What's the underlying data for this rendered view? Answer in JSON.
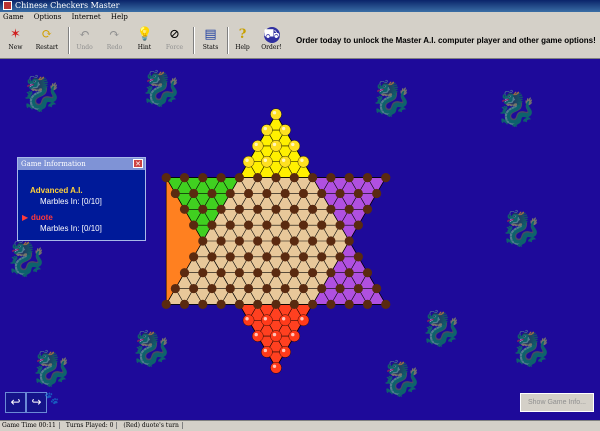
{
  "window": {
    "title": "Chinese Checkers Master"
  },
  "menu": [
    "Game",
    "Options",
    "Internet",
    "Help"
  ],
  "toolbar": [
    {
      "label": "New",
      "icon": "star-icon",
      "enabled": true
    },
    {
      "label": "Restart",
      "icon": "restart-icon",
      "enabled": true
    },
    {
      "label": "Undo",
      "icon": "undo-icon",
      "enabled": false
    },
    {
      "label": "Redo",
      "icon": "redo-icon",
      "enabled": false
    },
    {
      "label": "Hint",
      "icon": "lightbulb-icon",
      "enabled": true
    },
    {
      "label": "Force",
      "icon": "no-icon",
      "enabled": false
    },
    {
      "label": "Stats",
      "icon": "book-icon",
      "enabled": true
    },
    {
      "label": "Help",
      "icon": "help-icon",
      "enabled": true
    },
    {
      "label": "Order!",
      "icon": "cart-icon",
      "enabled": true
    }
  ],
  "promo_text": "Order today to unlock the Master A.I. computer player and other game options!",
  "game_info": {
    "title": "Game Information",
    "players": [
      {
        "name": "Advanced A.I.",
        "marbles_label": "Marbles In: [0/10]",
        "color": "#ffd23a",
        "active": false
      },
      {
        "name": "duote",
        "marbles_label": "Marbles In: [0/10]",
        "color": "#ff3a3a",
        "active": true
      }
    ]
  },
  "board": {
    "colors": {
      "top": "#fff000",
      "upper_right": "#b050e0",
      "lower_right": "#2020ff",
      "bottom": "#ff4020",
      "lower_left": "#ff8020",
      "upper_left": "#40d020",
      "center": "#e8c89a",
      "hole": "#5a2a10",
      "background": "#1e0a9a",
      "yellow_marble": "#ffe020",
      "red_marble": "#ff3a1a"
    }
  },
  "buttons": {
    "show_game_info": "Show Game Info..."
  },
  "nav_icons": [
    "back-arrow-icon",
    "forward-arrow-icon"
  ],
  "status": {
    "game_time": "Game Time 00:11",
    "turns": "Turns Played: 0",
    "turn_msg": "(Red) duote's turn"
  }
}
